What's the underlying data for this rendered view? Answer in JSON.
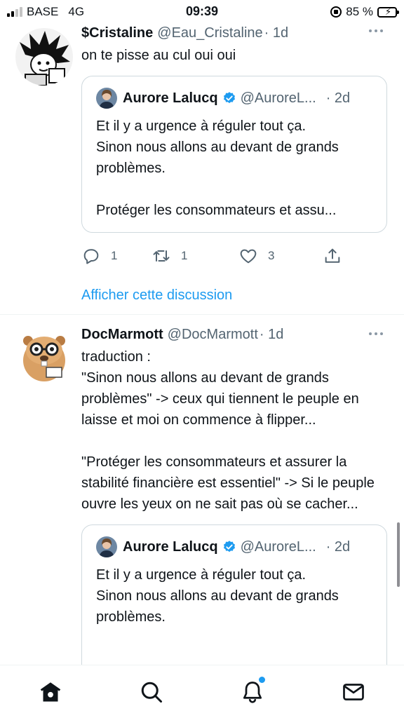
{
  "status_bar": {
    "carrier": "BASE",
    "network": "4G",
    "time": "09:39",
    "battery_percent": "85 %",
    "battery_level": 0.85,
    "battery_color": "#34c759"
  },
  "feed": {
    "tweets": [
      {
        "name": "$Cristaline",
        "handle": "@Eau_Cristaline",
        "time": "· 1d",
        "text": "on te pisse au cul oui oui",
        "quote": {
          "name": "Aurore Lalucq",
          "handle": "@AuroreL...",
          "time": "· 2d",
          "text": "Et il y a urgence à réguler tout ça.\nSinon nous allons au devant de grands problèmes.\n\nProtéger les consommateurs et assu..."
        },
        "actions": {
          "replies": "1",
          "retweets": "1",
          "likes": "3"
        },
        "thread_link": "Afficher cette discussion"
      },
      {
        "name": "DocMarmott",
        "handle": "@DocMarmott",
        "time": "· 1d",
        "text": "traduction :\n\"Sinon nous allons au devant de grands problèmes\" -> ceux qui tiennent le peuple en laisse et moi on commence à flipper...\n\n\"Protéger les consommateurs et assurer la stabilité financière est essentiel\" -> Si le peuple ouvre les yeux on ne sait pas où se cacher...",
        "quote": {
          "name": "Aurore Lalucq",
          "handle": "@AuroreL...",
          "time": "· 2d",
          "text": "Et il y a urgence à réguler tout ça.\nSinon nous allons au devant de grands problèmes."
        }
      }
    ]
  },
  "bottom_nav": {
    "items": [
      "home-icon",
      "search-icon",
      "notifications-icon",
      "messages-icon"
    ],
    "accent_color": "#1d9bf0"
  }
}
